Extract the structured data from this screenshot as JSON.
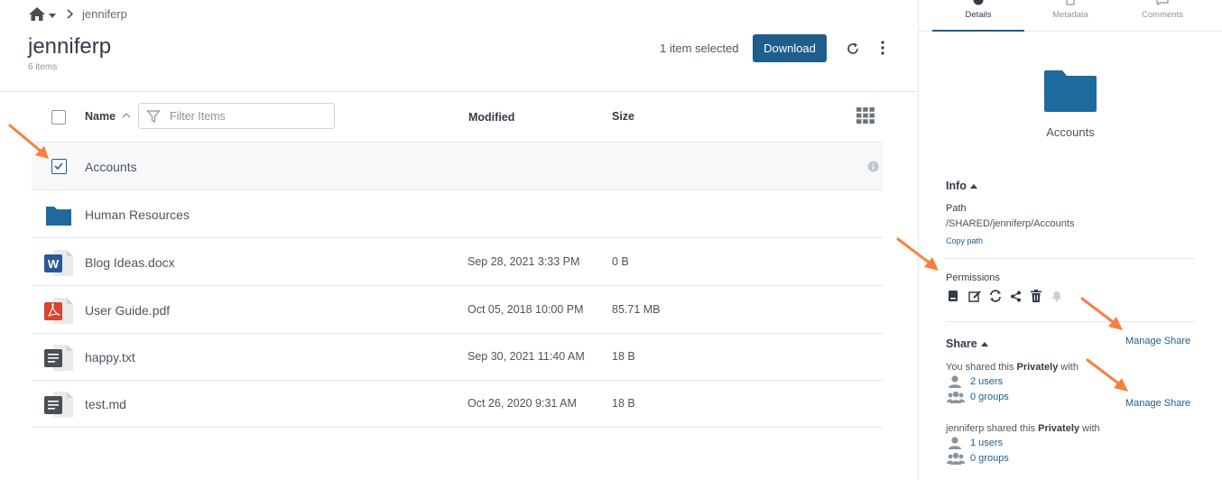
{
  "breadcrumb": {
    "current": "jenniferp"
  },
  "folder": {
    "title": "jenniferp",
    "item_count": "6 items"
  },
  "toolbar": {
    "selection_text": "1 item selected",
    "download_label": "Download"
  },
  "table": {
    "columns": {
      "name": "Name",
      "modified": "Modified",
      "size": "Size"
    },
    "filter_placeholder": "Filter Items",
    "rows": [
      {
        "name": "Accounts",
        "modified": "",
        "size": "",
        "type": "folder",
        "selected": true
      },
      {
        "name": "Human Resources",
        "modified": "",
        "size": "",
        "type": "folder",
        "selected": false
      },
      {
        "name": "Blog Ideas.docx",
        "modified": "Sep 28, 2021 3:33 PM",
        "size": "0 B",
        "type": "word"
      },
      {
        "name": "User Guide.pdf",
        "modified": "Oct 05, 2018 10:00 PM",
        "size": "85.71 MB",
        "type": "pdf"
      },
      {
        "name": "happy.txt",
        "modified": "Sep 30, 2021 11:40 AM",
        "size": "18 B",
        "type": "text"
      },
      {
        "name": "test.md",
        "modified": "Oct 26, 2020 9:31 AM",
        "size": "18 B",
        "type": "text"
      }
    ]
  },
  "side": {
    "tabs": [
      {
        "label": "Details",
        "icon": "details-icon",
        "active": true
      },
      {
        "label": "Metadata",
        "icon": "metadata-icon",
        "active": false
      },
      {
        "label": "Comments",
        "icon": "comments-icon",
        "active": false
      }
    ],
    "selected_name": "Accounts",
    "info": {
      "heading": "Info",
      "path_label": "Path",
      "path_value": "/SHARED/jenniferp/Accounts",
      "copy_path": "Copy path"
    },
    "permissions": {
      "label": "Permissions",
      "icons": [
        "view-icon",
        "edit-icon",
        "sync-icon",
        "share-icon",
        "delete-icon",
        "notify-icon"
      ]
    },
    "share": {
      "heading": "Share",
      "manage_label": "Manage Share",
      "entries": [
        {
          "prefix": "You shared this ",
          "mode": "Privately",
          "suffix": " with",
          "users": "2 users",
          "groups": "0 groups"
        },
        {
          "prefix": "jenniferp shared this ",
          "mode": "Privately",
          "suffix": " with",
          "users": "1 users",
          "groups": "0 groups"
        }
      ]
    }
  },
  "colors": {
    "accent": "#1e5d8c",
    "folder": "#1e6a9c",
    "annotation": "#f5813f",
    "word": "#2b5797",
    "pdf": "#d9432f",
    "text": "#4a4f55"
  }
}
